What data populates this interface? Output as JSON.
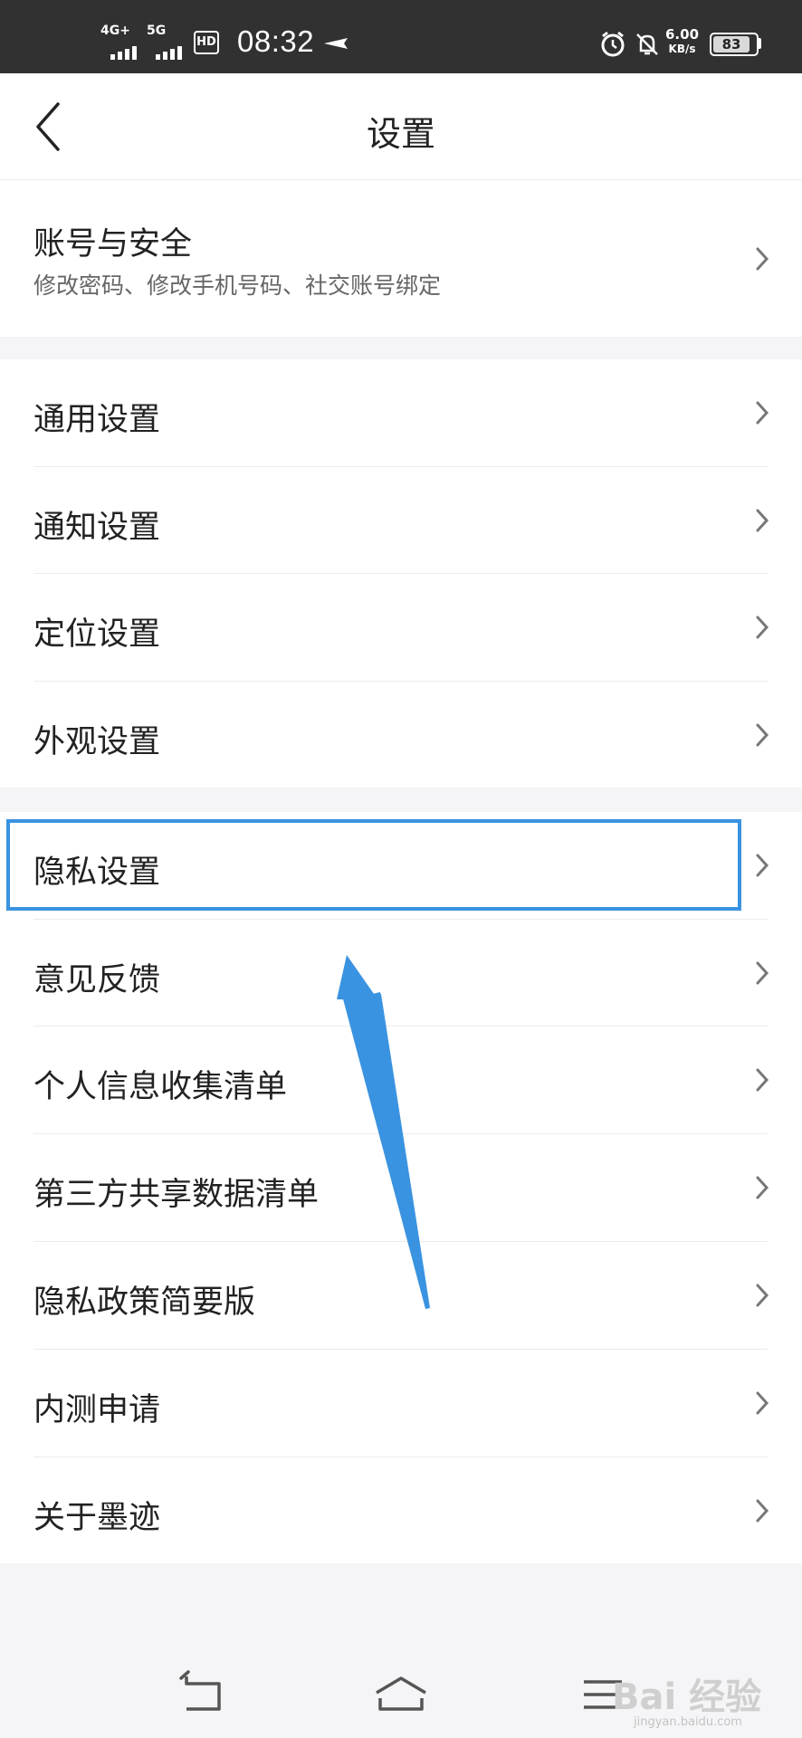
{
  "status_bar": {
    "net1": "4G+",
    "net2": "5G",
    "hd_label": "HD",
    "time": "08:32",
    "speed_value": "6.00",
    "speed_unit": "KB/s",
    "battery": "83",
    "icons": [
      "signal-icon",
      "signal-icon",
      "hd-icon",
      "airplane-icon",
      "alarm-icon",
      "bell-off-icon",
      "battery-icon"
    ]
  },
  "header": {
    "title": "设置",
    "back_icon": "chevron-left-icon"
  },
  "sections": {
    "account": {
      "label": "账号与安全",
      "subtitle": "修改密码、修改手机号码、社交账号绑定"
    },
    "general": [
      {
        "label": "通用设置"
      },
      {
        "label": "通知设置"
      },
      {
        "label": "定位设置"
      },
      {
        "label": "外观设置"
      }
    ],
    "more": [
      {
        "label": "隐私设置"
      },
      {
        "label": "意见反馈"
      },
      {
        "label": "个人信息收集清单"
      },
      {
        "label": "第三方共享数据清单"
      },
      {
        "label": "隐私政策简要版"
      },
      {
        "label": "内测申请"
      },
      {
        "label": "关于墨迹"
      }
    ]
  },
  "annotation": {
    "highlight_color": "#3a93e0",
    "arrow_color": "#3a93e0"
  },
  "bottom_nav": {
    "icons": [
      "back-nav-icon",
      "home-nav-icon",
      "menu-nav-icon"
    ]
  },
  "watermark": {
    "text": "Bai 经验",
    "sub": "jingyan.baidu.com"
  }
}
